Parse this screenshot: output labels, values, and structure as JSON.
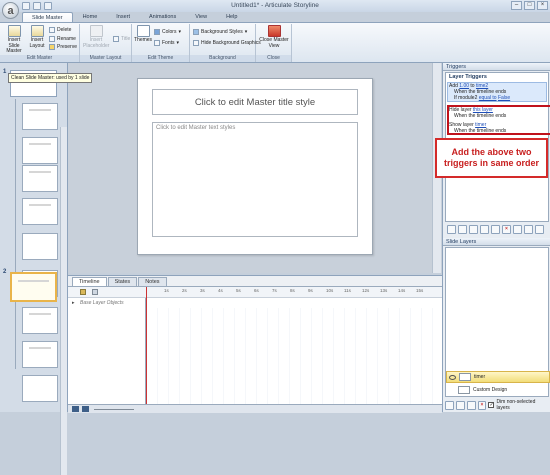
{
  "window": {
    "title": "Untitled1* - Articulate Storyline"
  },
  "app_logo": "a",
  "tabs": [
    {
      "label": "Slide Master",
      "active": true
    },
    {
      "label": "Home"
    },
    {
      "label": "Insert"
    },
    {
      "label": "Animations"
    },
    {
      "label": "View"
    },
    {
      "label": "Help"
    }
  ],
  "ribbon": {
    "edit_master": {
      "insert_slide_master": "Insert Slide Master",
      "insert_layout": "Insert Layout",
      "delete": "Delete",
      "rename": "Rename",
      "preserve": "Preserve",
      "group_label": "Edit Master"
    },
    "master_layout": {
      "insert_placeholder": "Insert Placeholder",
      "title_check": "Title",
      "group_label": "Master Layout"
    },
    "edit_theme": {
      "themes": "Themes",
      "colors": "Colors",
      "fonts": "Fonts",
      "group_label": "Edit Theme"
    },
    "background": {
      "background_styles": "Background Styles",
      "hide_background_graphics": "Hide Background Graphics",
      "group_label": "Background"
    },
    "close": {
      "close_master_view": "Close Master View",
      "group_label": "Close"
    }
  },
  "left_panel": {
    "master_number": "1",
    "layout_number": "2",
    "tooltip": "Clean Slide Master: used by 1 slide"
  },
  "slide": {
    "title_placeholder": "Click to edit Master title style",
    "text_placeholder": "Click to edit Master text styles"
  },
  "timeline": {
    "tabs": [
      "Timeline",
      "States",
      "Notes"
    ],
    "row_label": "Base Layer Objects",
    "ticks": [
      "1s",
      "2s",
      "3s",
      "4s",
      "5s",
      "6s",
      "7s",
      "8s",
      "9s",
      "10s",
      "11s",
      "12s",
      "13s",
      "14s",
      "15s"
    ]
  },
  "triggers": {
    "header": "Triggers",
    "title": "Layer Triggers",
    "t1_line1_prefix": "Add",
    "t1_line1_value": "1.00",
    "t1_line1_mid": "to",
    "t1_line1_var": "time2",
    "t1_line2": "When the timeline ends",
    "t1_line3_prefix": "If",
    "t1_line3_var": "module2",
    "t1_line3_op": "equal to",
    "t1_line3_val": "False",
    "t2_line1_prefix": "Hide layer",
    "t2_line1_link": "this layer",
    "t2_line2": "When the timeline ends",
    "t3_line1_prefix": "Show layer",
    "t3_line1_link": "timer",
    "t3_line2": "When the timeline ends"
  },
  "callout": {
    "text": "Add the above two triggers in same order"
  },
  "slide_layers": {
    "header": "Slide Layers",
    "layers": [
      {
        "name": "timer",
        "selected": true
      },
      {
        "name": "Custom Design",
        "selected": false
      }
    ],
    "dim_label": "Dim non-selected layers"
  },
  "colors": {
    "accent_red": "#c0121c",
    "link_blue": "#1f4fb8",
    "selection_gold": "#e9b44a"
  }
}
